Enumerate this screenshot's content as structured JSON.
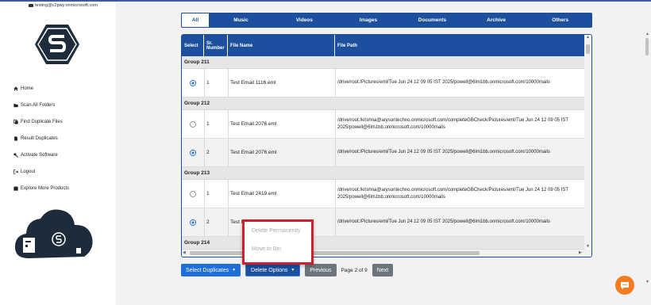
{
  "user": {
    "email": "testing@c2pwy.onmicrosoft.com"
  },
  "nav": [
    {
      "label": "Home",
      "icon": "home-icon"
    },
    {
      "label": "Scan All Folders",
      "icon": "folder-icon"
    },
    {
      "label": "Find Duplicate Files",
      "icon": "copy-icon"
    },
    {
      "label": "Result Duplicates",
      "icon": "file-icon"
    },
    {
      "label": "Activate Software",
      "icon": "key-icon"
    },
    {
      "label": "Logout",
      "icon": "logout-icon"
    },
    {
      "label": "Explore More Products",
      "icon": "box-icon"
    }
  ],
  "tabs": [
    "All",
    "Music",
    "Videos",
    "Images",
    "Documents",
    "Archive",
    "Others"
  ],
  "table": {
    "headers": {
      "select": "Select",
      "sr1": "Sr.",
      "sr2": "Number",
      "file_name": "File Name",
      "file_path": "File Path"
    },
    "groups": [
      {
        "label": "Group 211",
        "rows": [
          {
            "checked": true,
            "sr": "1",
            "name": "Test Email 1116.eml",
            "path1": "/drive/root:/Pictures/eml/Tue Jun 24 12 09 05 IST 2025/powell@6lm1bb.onmicrosoft.com/10000mails",
            "path2": ""
          }
        ]
      },
      {
        "label": "Group 212",
        "rows": [
          {
            "checked": false,
            "sr": "1",
            "name": "Test Email 2076.eml",
            "path1": "/drive/root:/krishna@arysontechno.onmicrosoft.com/completeGBCheck/Pictures/eml/Tue Jun 24 12 09 05 IST",
            "path2": "2025/powell@6lm1bb.onmicrosoft.com/10000mails"
          },
          {
            "checked": true,
            "sr": "2",
            "name": "Test Email 2076.eml",
            "path1": "/drive/root:/Pictures/eml/Tue Jun 24 12 09 05 IST 2025/powell@6lm1bb.onmicrosoft.com/10000mails",
            "path2": ""
          }
        ]
      },
      {
        "label": "Group 213",
        "rows": [
          {
            "checked": false,
            "sr": "1",
            "name": "Test Email 2419.eml",
            "path1": "/drive/root:/krishna@arysontechno.onmicrosoft.com/completeGBCheck/Pictures/eml/Tue Jun 24 12 09 05 IST",
            "path2": "2025/powell@6lm1bb.onmicrosoft.com/10000mails"
          },
          {
            "checked": true,
            "sr": "2",
            "name": "Test E",
            "path1": "/drive/root:/Pictures/eml/Tue Jun 24 12 09 05 IST 2025/powell@6lm1bb.onmicrosoft.com/10000mails",
            "path2": ""
          }
        ]
      },
      {
        "label": "Group 214",
        "rows": []
      }
    ]
  },
  "buttons": {
    "select_duplicates": "Select Duplicates",
    "delete_options": "Delete Options",
    "previous": "Previous",
    "page_indicator": "Page 2 of 9",
    "next": "Next"
  },
  "dropdown": {
    "items": [
      "Delete Permanently",
      "Move to Bin"
    ]
  },
  "colors": {
    "primary": "#1c4f9e",
    "button_blue": "#1e6fd9",
    "highlight_red": "#d0202e",
    "chat_orange": "#f47c20"
  }
}
